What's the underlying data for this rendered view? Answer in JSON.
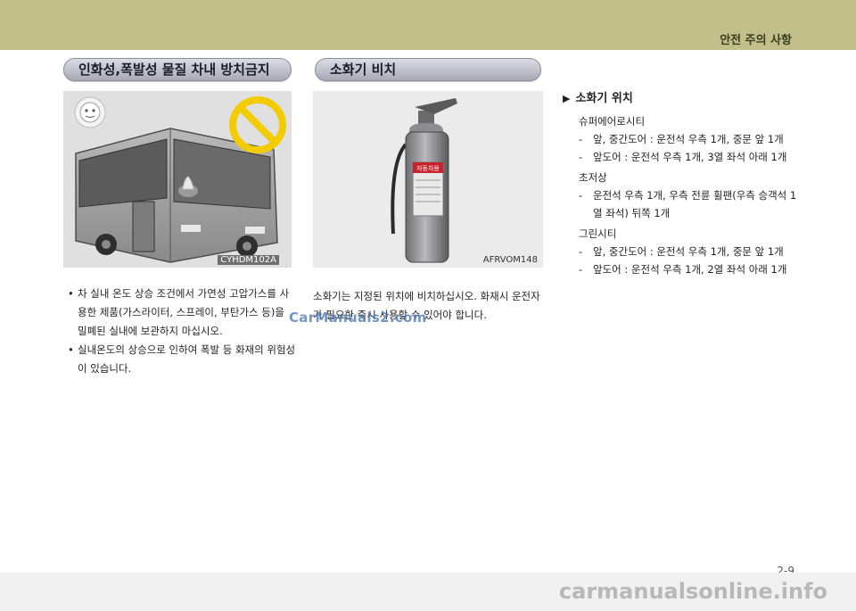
{
  "header": {
    "section_title": "안전 주의 사항"
  },
  "left": {
    "heading": "인화성,폭발성 물질 차내 방치금지",
    "figure_code": "CYHDM102A",
    "bullets": [
      "차 실내 온도 상승 조건에서 가연성 고압가스를 사용한 제품(가스라이터, 스프레이, 부탄가스 등)을 밀폐된 실내에 보관하지 마십시오.",
      "실내온도의 상승으로 인하여 폭발 등 화재의 위험성이 있습니다."
    ]
  },
  "middle": {
    "heading": "소화기 비치",
    "figure_code": "AFRVOM148",
    "extinguisher_label": "자동차용",
    "paragraph": "소화기는 지정된 위치에 비치하십시오. 화재시 운전자가 필요한 즉시 사용할 수 있어야 합니다."
  },
  "right": {
    "heading": "소화기 위치",
    "groups": [
      {
        "name": "슈퍼에어로시티",
        "items": [
          "앞, 중간도어 : 운전석 우측 1개, 중문 앞 1개",
          "앞도어 : 운전석 우측 1개, 3열 좌석 아래 1개"
        ]
      },
      {
        "name": "초저상",
        "items": [
          "운전석 우측 1개, 우측 전륜 휠팬(우측 승객석 1열 좌석) 뒤쪽 1개"
        ]
      },
      {
        "name": "그린시티",
        "items": [
          "앞, 중간도어 : 운전석 우측 1개, 중문 앞 1개",
          "앞도어 : 운전석 우측 1개, 2열 좌석 아래 1개"
        ]
      }
    ]
  },
  "footer": {
    "page_number": "2-9",
    "watermark_mid": "CarManuals2.com",
    "watermark_bottom": "carmanualsonline.info"
  },
  "colors": {
    "header_band": "#c2c08a",
    "prohibit_sign": "#f2cc00",
    "extinguisher": "#8a8a8e"
  }
}
